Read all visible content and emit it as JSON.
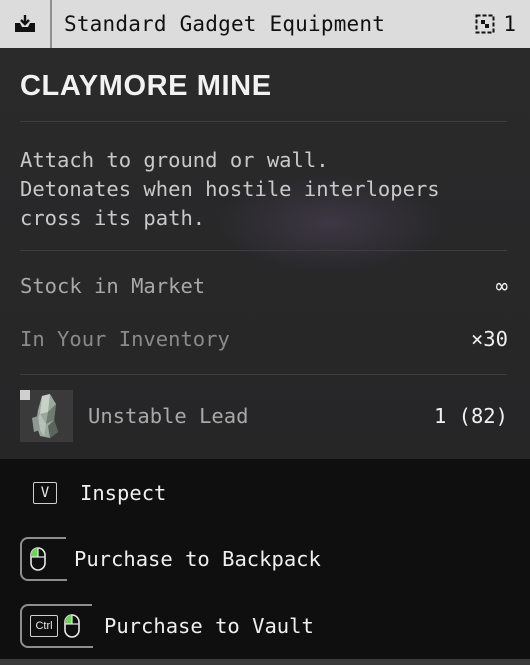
{
  "header": {
    "category_icon": "download-tray-icon",
    "title": "Standard Gadget Equipment",
    "count_icon": "grid-stack-icon",
    "count": "1"
  },
  "item": {
    "name": "CLAYMORE MINE",
    "description": "Attach to ground or wall.\nDetonates when hostile interlopers\ncross its path."
  },
  "stats": [
    {
      "label": "Stock in Market",
      "value": "∞"
    },
    {
      "label": "In Your Inventory",
      "value": "×30"
    }
  ],
  "cost": {
    "icon": "crystal-ore-icon",
    "name": "Unstable Lead",
    "value": "1 (82)"
  },
  "actions": [
    {
      "key": "V",
      "label": "Inspect"
    },
    {
      "key": "mouse-left-click-icon",
      "label": "Purchase to Backpack"
    },
    {
      "key": "Ctrl",
      "label": "Purchase to Vault"
    }
  ],
  "colors": {
    "header_bg": "#dcdcdc",
    "card_bg": "#2a2a2b",
    "action_bg": "#0f0f10",
    "mouse_accent": "#6fd35a"
  }
}
